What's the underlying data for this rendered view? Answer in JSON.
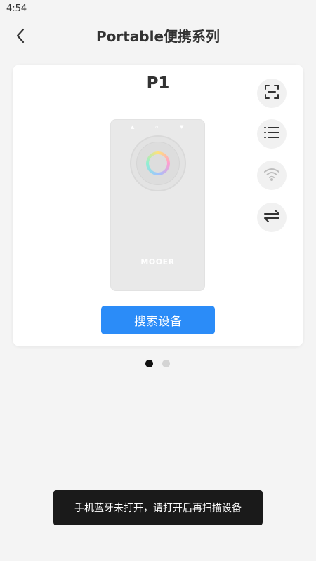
{
  "status_bar": {
    "time": "4:54"
  },
  "header": {
    "title": "Portable便携系列",
    "back_icon": "chevron-left-icon"
  },
  "card": {
    "model_name": "P1",
    "device_brand": "MOOER",
    "device_triangles": [
      "▲",
      "⌂",
      "▼"
    ],
    "side_actions": [
      {
        "icon": "scan-icon"
      },
      {
        "icon": "list-icon"
      },
      {
        "icon": "wifi-icon"
      },
      {
        "icon": "swap-icon"
      }
    ],
    "search_button_label": "搜索设备"
  },
  "pager": {
    "total": 2,
    "active_index": 0
  },
  "toast": {
    "message": "手机蓝牙未打开，请打开后再扫描设备"
  },
  "colors": {
    "accent": "#2b8cf8",
    "background": "#f4f4f4",
    "toast_bg": "#1a1a1a"
  }
}
